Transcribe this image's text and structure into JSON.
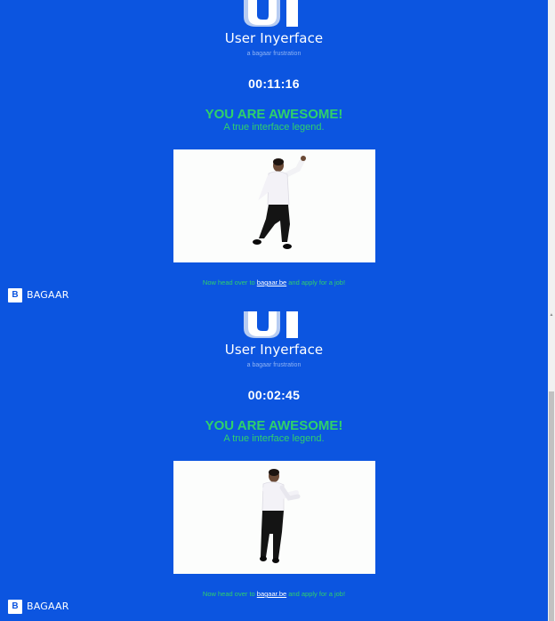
{
  "brand": {
    "app_title": "User Inyerface",
    "app_subtitle": "a bagaar frustration",
    "company": "BAGAAR",
    "company_icon_letter": "B",
    "accent_color": "#0c55e0",
    "success_color": "#2fd16a"
  },
  "result_screens": [
    {
      "timer": "00:11:16",
      "headline": "YOU ARE AWESOME!",
      "tagline": "A true interface legend.",
      "gif_alt": "dancing man celebrating",
      "cta_before": "Now head over to ",
      "cta_link": "bagaar.be",
      "cta_after": " and apply for a job!"
    },
    {
      "timer": "00:02:45",
      "headline": "YOU ARE AWESOME!",
      "tagline": "A true interface legend.",
      "gif_alt": "dancing man celebrating",
      "cta_before": "Now head over to ",
      "cta_link": "bagaar.be",
      "cta_after": " and apply for a job!"
    }
  ],
  "scrollbar": {
    "up_arrow": "▲"
  }
}
